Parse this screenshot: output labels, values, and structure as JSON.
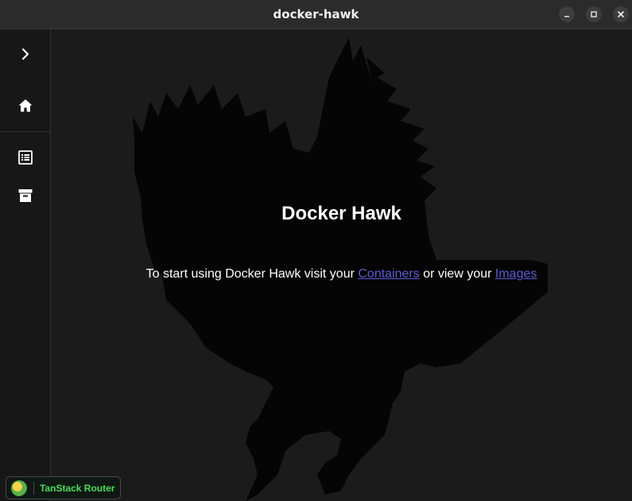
{
  "window": {
    "title": "docker-hawk",
    "controls": {
      "minimize_icon": "minimize-icon",
      "maximize_icon": "maximize-icon",
      "close_icon": "close-icon"
    }
  },
  "sidebar": {
    "items": [
      {
        "name": "expand",
        "icon": "chevron-right-icon"
      },
      {
        "name": "home",
        "icon": "home-icon"
      },
      {
        "name": "containers",
        "icon": "list-icon"
      },
      {
        "name": "images",
        "icon": "archive-icon"
      }
    ]
  },
  "main": {
    "heading": "Docker Hawk",
    "intro_prefix": "To start using Docker Hawk visit your ",
    "containers_link": "Containers",
    "intro_middle": " or view your ",
    "images_link": "Images"
  },
  "devtools": {
    "label": "TanStack Router"
  },
  "colors": {
    "link": "#5b5bd6",
    "background": "#1b1b1b",
    "devtools_text": "#4ade5a"
  }
}
